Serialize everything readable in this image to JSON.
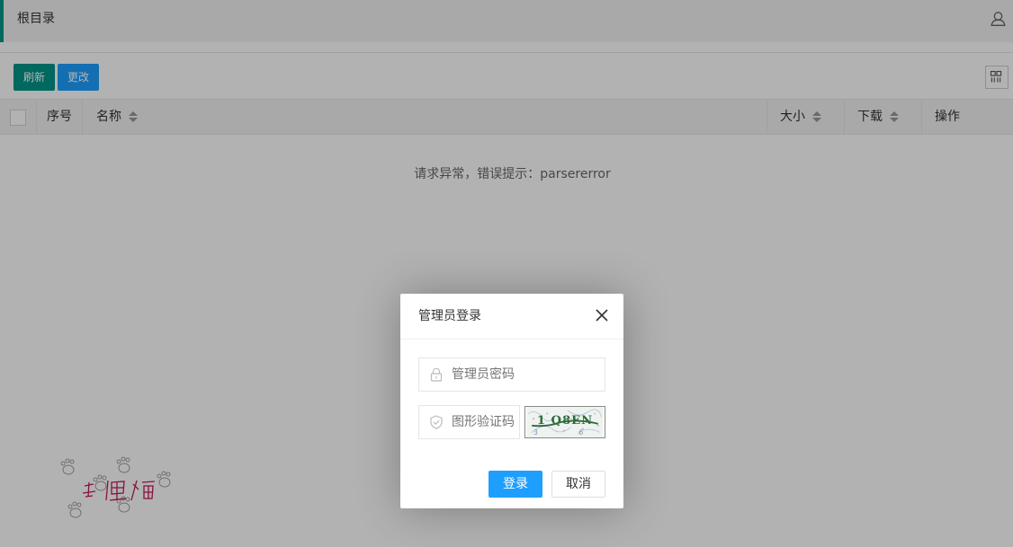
{
  "header": {
    "title": "根目录",
    "user_icon": "user-icon"
  },
  "toolbar": {
    "refresh_label": "刷新",
    "change_label": "更改",
    "columns_icon": "grid-icon"
  },
  "table": {
    "columns": [
      {
        "label": "序号",
        "sortable": false
      },
      {
        "label": "名称",
        "sortable": true
      },
      {
        "label": "大小",
        "sortable": true
      },
      {
        "label": "下载",
        "sortable": true
      },
      {
        "label": "操作",
        "sortable": false
      }
    ],
    "empty_message": "请求异常，错误提示：parsererror"
  },
  "dialog": {
    "title": "管理员登录",
    "password_placeholder": "管理员密码",
    "captcha_placeholder": "图形验证码",
    "captcha_text": "1 Q8EN 3 6",
    "ok_label": "登录",
    "cancel_label": "取消"
  },
  "colors": {
    "primary_green": "#009688",
    "primary_blue": "#1E9FFF",
    "logo_pink": "#c2185b"
  }
}
